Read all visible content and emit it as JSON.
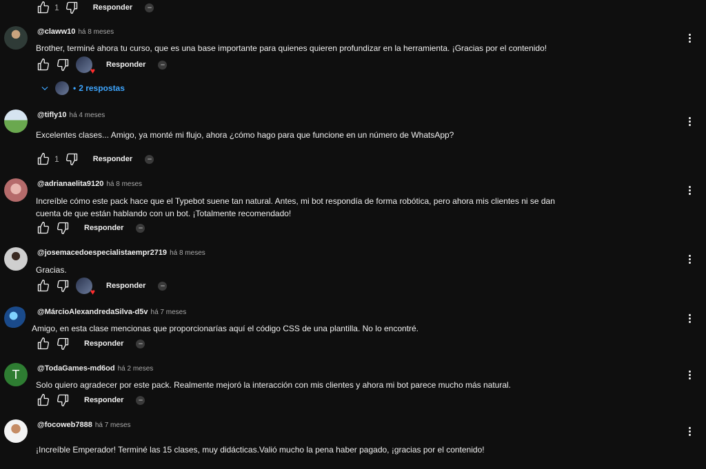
{
  "labels": {
    "reply": "Responder",
    "dislike": "",
    "like": ""
  },
  "top_row": {
    "likes": "1"
  },
  "comments": [
    {
      "handle": "@claww10",
      "time": "há 8 meses",
      "text": "Brother, terminé ahora tu curso, que es una base importante para quienes quieren profundizar en la herramienta. ¡Gracias por el contenido!",
      "likes": "",
      "replies_label": "2 respostas"
    },
    {
      "handle": "@tifly10",
      "time": "há 4 meses",
      "text": "Excelentes clases... Amigo, ya monté mi flujo, ahora ¿cómo hago para que funcione en un número de WhatsApp?",
      "likes": "1"
    },
    {
      "handle": "@adrianaelita9120",
      "time": "há 8 meses",
      "text_line1": "Increíble cómo este pack hace que el Typebot suene tan natural. Antes, mi bot respondía de forma robótica, pero ahora mis clientes ni se dan",
      "text_line2": "cuenta de que están hablando con un bot. ¡Totalmente recomendado!"
    },
    {
      "handle": "@josemacedoespecialistaempr2719",
      "time": "há 8 meses",
      "text": "Gracias."
    },
    {
      "handle": "@MárcioAlexandredaSilva-d5v",
      "time": "há 7 meses",
      "text": "Amigo, en esta clase mencionas que proporcionarías aquí el código CSS de una plantilla. No lo encontré."
    },
    {
      "handle": "@TodaGames-md6od",
      "time": "há 2 meses",
      "text": "Solo quiero agradecer por este pack. Realmente mejoró la interacción con mis clientes y ahora mi bot parece mucho más natural.",
      "avatar_letter": "T"
    },
    {
      "handle": "@focoweb7888",
      "time": "há 7 meses",
      "text": "¡Increíble Emperador! Terminé las 15 clases, muy didácticas.Valió mucho la pena haber pagado, ¡gracias por el contenido!"
    }
  ],
  "colors": {
    "background": "#0f0f0f",
    "link": "#3ea6ff",
    "heart": "#ff2d2d",
    "avatar_t": "#2e7d32"
  },
  "icons": [
    "thumb-up-icon",
    "thumb-down-icon",
    "more-vert-icon",
    "chevron-down-icon",
    "heart-icon"
  ]
}
